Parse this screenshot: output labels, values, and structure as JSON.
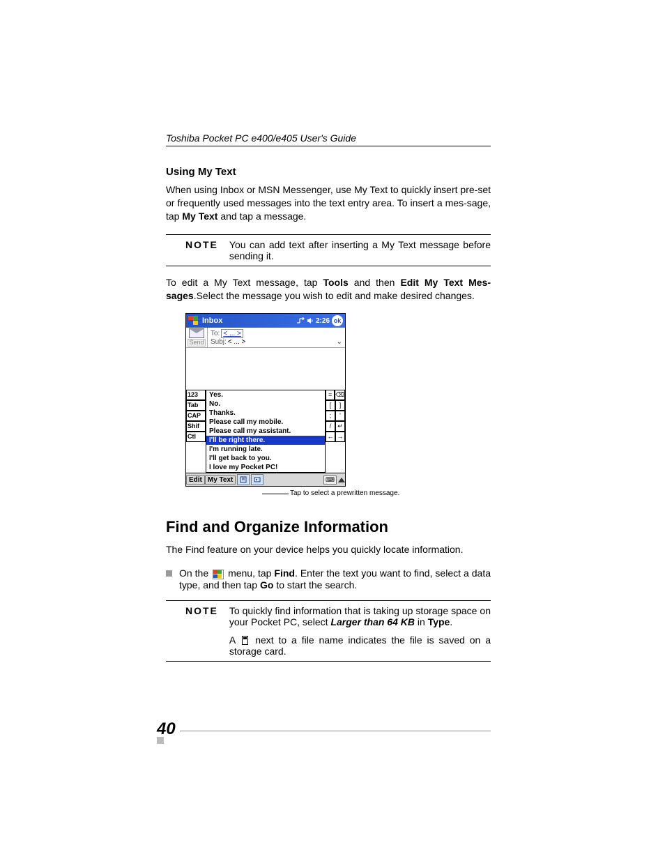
{
  "header": {
    "title": "Toshiba Pocket PC  e400/e405 User's Guide"
  },
  "section1": {
    "title": "Using My Text",
    "para1_a": "When using Inbox or MSN Messenger, use My Text to quickly insert pre-set or frequently used messages into the text entry area. To insert a mes-sage, tap ",
    "para1_bold": "My Text",
    "para1_b": " and tap a message.",
    "note_label": "NOTE",
    "note_text": "You can add text after inserting a My Text message before sending it.",
    "para2_a": "To edit a My Text message, tap ",
    "para2_bold1": "Tools",
    "para2_b": " and then ",
    "para2_bold2": "Edit My Text Mes-sages",
    "para2_c": ".Select the message you wish to edit and make desired changes."
  },
  "ppc": {
    "title": "Inbox",
    "time": "2:26",
    "ok": "ok",
    "send": "Send",
    "to_label": "To:",
    "to_val": "< ... >",
    "subj_label": "Subj:",
    "subj_val": "< ... >",
    "kbd_left": [
      "123",
      "Tab",
      "CAP",
      "Shif",
      "Ctl"
    ],
    "mytext_items": [
      "Yes.",
      "No.",
      "Thanks.",
      "Please call my mobile.",
      "Please call my assistant.",
      "I'll be right there.",
      "I'm running late.",
      "I'll get back to you.",
      "I love my Pocket PC!"
    ],
    "selected_index": 5,
    "kbd_right_rows": [
      [
        "=",
        "⌫"
      ],
      [
        "[",
        "]"
      ],
      [
        ";",
        "'"
      ],
      [
        "/",
        "↵"
      ],
      [
        "←",
        "→"
      ]
    ],
    "footer_edit": "Edit",
    "footer_mytext": "My Text",
    "callout": "Tap to select a prewritten message."
  },
  "section2": {
    "title": "Find and Organize Information",
    "para1": "The Find feature on your device helps you quickly locate information.",
    "bullet_a": "On the ",
    "bullet_b": " menu, tap ",
    "bullet_bold1": "Find",
    "bullet_c": ". Enter the text you want to find, select a data type, and then tap ",
    "bullet_bold2": "Go",
    "bullet_d": " to start the search.",
    "note_label": "NOTE",
    "note_p1_a": "To quickly find information that is taking up storage space on your Pocket PC, select ",
    "note_p1_bi": "Larger than 64 KB",
    "note_p1_b": " in ",
    "note_p1_bold": "Type",
    "note_p1_c": ".",
    "note_p2_a": "A ",
    "note_p2_b": " next to a file name indicates the file is saved on a storage card."
  },
  "page_number": "40"
}
